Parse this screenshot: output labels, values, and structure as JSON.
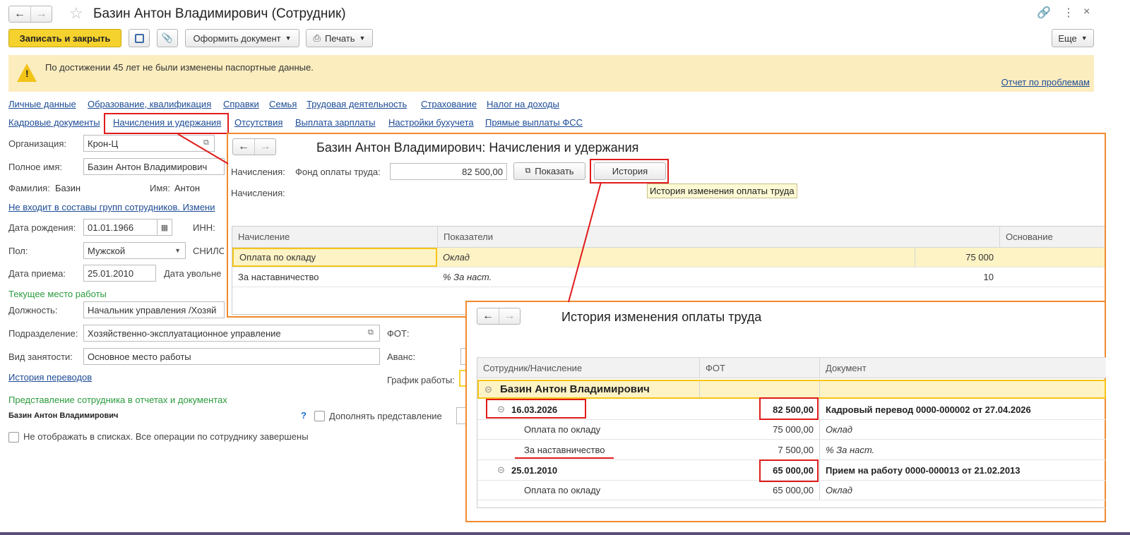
{
  "window": {
    "title": "Базин Антон Владимирович (Сотрудник)"
  },
  "toolbar": {
    "save_close": "Записать и закрыть",
    "make_doc": "Оформить документ",
    "print": "Печать",
    "more": "Еще"
  },
  "warning": {
    "text": "По достижении 45 лет не были изменены паспортные данные.",
    "report_link": "Отчет по проблемам"
  },
  "nav_links_row1": [
    "Личные данные",
    "Образование, квалификация",
    "Справки",
    "Семья",
    "Трудовая деятельность",
    "Страхование",
    "Налог на доходы"
  ],
  "nav_links_row2": [
    "Кадровые документы",
    "Начисления и удержания",
    "Отсутствия",
    "Выплата зарплаты",
    "Настройки бухучета",
    "Прямые выплаты ФСС"
  ],
  "form": {
    "org_label": "Организация:",
    "org_value": "Крон-Ц",
    "fullname_label": "Полное имя:",
    "fullname_value": "Базин Антон Владимирович",
    "surname_label": "Фамилия:",
    "surname_value": "Базин",
    "name_label": "Имя:",
    "name_value": "Антон",
    "groups_link": "Не входит в составы групп сотрудников. Измени",
    "birth_label": "Дата рождения:",
    "birth_value": "01.01.1966",
    "inn_label": "ИНН:",
    "gender_label": "Пол:",
    "gender_value": "Мужской",
    "snils_label": "СНИЛС",
    "hire_label": "Дата приема:",
    "hire_value": "25.01.2010",
    "fire_label": "Дата увольне",
    "current_work": "Текущее место работы",
    "position_label": "Должность:",
    "position_value": "Начальник управления /Хозяй",
    "dept_label": "Подразделение:",
    "dept_value": "Хозяйственно-эксплуатационное управление",
    "fot_label": "ФОТ:",
    "employment_label": "Вид занятости:",
    "employment_value": "Основное место работы",
    "advance_label": "Аванс:",
    "transfers_link": "История переводов",
    "schedule_label": "График работы:",
    "representation_title": "Представление сотрудника в отчетах и документах",
    "representation_value": "Базин Антон Владимирович",
    "question": "?",
    "append_repr": "Дополнять представление",
    "hide_in_lists": "Не отображать в списках. Все операции по сотруднику завершены"
  },
  "accruals": {
    "title": "Базин Антон Владимирович: Начисления и удержания",
    "accruals_label": "Начисления:",
    "fund_label": "Фонд оплаты труда:",
    "fund_value": "82 500,00",
    "show_btn": "Показать",
    "history_btn": "История",
    "accruals_label2": "Начисления:",
    "tooltip": "История изменения оплаты труда",
    "columns": [
      "Начисление",
      "Показатели",
      "Основание"
    ],
    "rows": [
      {
        "name": "Оплата по окладу",
        "indicator": "Оклад",
        "value": "75 000"
      },
      {
        "name": "За наставничество",
        "indicator": "%  За наст.",
        "value": "10"
      }
    ]
  },
  "history": {
    "title": "История изменения оплаты труда",
    "columns": [
      "Сотрудник/Начисление",
      "ФОТ",
      "Документ"
    ],
    "employee": "Базин Антон Владимирович",
    "groups": [
      {
        "date": "16.03.2026",
        "fot": "82 500,00",
        "doc": "Кадровый перевод 0000-000002 от 27.04.2026",
        "items": [
          {
            "name": "Оплата по окладу",
            "fot": "75 000,00",
            "doc": "Оклад"
          },
          {
            "name": "За наставничество",
            "fot": "7 500,00",
            "doc": "%  За наст."
          }
        ]
      },
      {
        "date": "25.01.2010",
        "fot": "65 000,00",
        "doc": "Прием на работу 0000-000013 от 21.02.2013",
        "items": [
          {
            "name": "Оплата по окладу",
            "fot": "65 000,00",
            "doc": "Оклад"
          }
        ]
      }
    ]
  },
  "colors": {
    "accent_yellow": "#f5d22e",
    "warning_bg": "#fcedbf",
    "highlight_row": "#fdf3c5",
    "callout_orange": "#f08a2e",
    "callout_red": "#e01b1b",
    "link": "#1d4c95",
    "section_green": "#2b9b3e"
  }
}
